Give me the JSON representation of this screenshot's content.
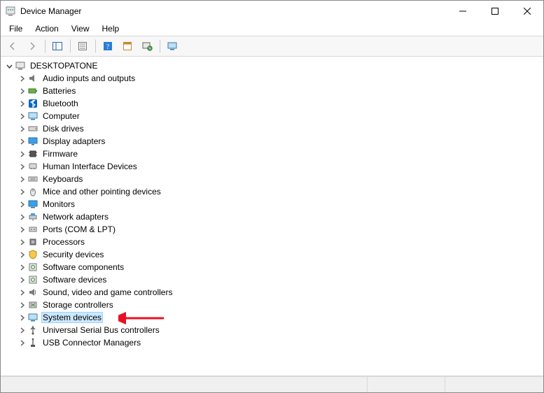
{
  "titlebar": {
    "title": "Device Manager"
  },
  "menubar": {
    "items": [
      "File",
      "Action",
      "View",
      "Help"
    ]
  },
  "toolbar": {
    "back": "back-icon",
    "forward": "forward-icon",
    "show": "show-hide-tree-icon",
    "props": "properties-icon",
    "help": "help-icon",
    "ribbon": "action-center-icon",
    "scan": "scan-hardware-icon",
    "monitor2": "resources-by-connection-icon"
  },
  "tree": {
    "root": {
      "label": "DESKTOPATONE",
      "expanded": true
    },
    "children": [
      {
        "label": "Audio inputs and outputs",
        "icon": "speaker"
      },
      {
        "label": "Batteries",
        "icon": "battery"
      },
      {
        "label": "Bluetooth",
        "icon": "bluetooth"
      },
      {
        "label": "Computer",
        "icon": "computer"
      },
      {
        "label": "Disk drives",
        "icon": "disk"
      },
      {
        "label": "Display adapters",
        "icon": "display"
      },
      {
        "label": "Firmware",
        "icon": "chip"
      },
      {
        "label": "Human Interface Devices",
        "icon": "hid"
      },
      {
        "label": "Keyboards",
        "icon": "keyboard"
      },
      {
        "label": "Mice and other pointing devices",
        "icon": "mouse"
      },
      {
        "label": "Monitors",
        "icon": "monitor"
      },
      {
        "label": "Network adapters",
        "icon": "network"
      },
      {
        "label": "Ports (COM & LPT)",
        "icon": "port"
      },
      {
        "label": "Processors",
        "icon": "cpu"
      },
      {
        "label": "Security devices",
        "icon": "security"
      },
      {
        "label": "Software components",
        "icon": "software"
      },
      {
        "label": "Software devices",
        "icon": "software"
      },
      {
        "label": "Sound, video and game controllers",
        "icon": "sound"
      },
      {
        "label": "Storage controllers",
        "icon": "storage"
      },
      {
        "label": "System devices",
        "icon": "system",
        "selected": true
      },
      {
        "label": "Universal Serial Bus controllers",
        "icon": "usb"
      },
      {
        "label": "USB Connector Managers",
        "icon": "usbconn"
      }
    ]
  },
  "annotation": {
    "arrow_color": "#e81123"
  }
}
